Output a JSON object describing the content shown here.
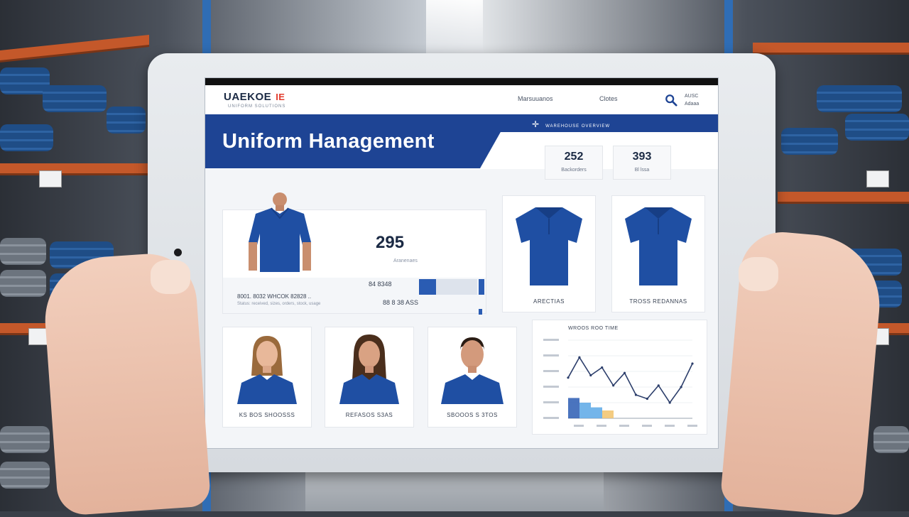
{
  "app": {
    "logo": "UAEKOE",
    "logo_mark": "IE",
    "logo_subtitle": "UNIFORM SOLUTIONS",
    "nav": [
      "Marsuuanos",
      "Clotes"
    ],
    "top_right": [
      "AUSC",
      "Adaaa"
    ]
  },
  "hero": {
    "title": "Uniform Hanagement",
    "right_text": "WAREHOUSE OVERVIEW"
  },
  "stats": [
    {
      "value": "252",
      "label": "Backorders"
    },
    {
      "value": "393",
      "label": "Bl lssa"
    }
  ],
  "summary": {
    "value": "295",
    "label": "Aranenaes",
    "footer_line1": "8001. 8032 WHCOK 82828 ..",
    "footer_line2": "Status: received, sizes, orders, stock, usage",
    "footer_num1": "84 8348",
    "footer_num2": "88 8 38 ASS"
  },
  "products": [
    {
      "label": "ARECTIAS"
    },
    {
      "label": "TROSS REDANNAS"
    }
  ],
  "staff": [
    {
      "label": "KS BOS SHOOSSS"
    },
    {
      "label": "REFASOS S3AS"
    },
    {
      "label": "SBOOOS S 3TOS"
    }
  ],
  "chart": {
    "title": "WROOS ROO TIME",
    "ylabels": [
      "",
      "",
      "",
      "",
      "",
      ""
    ],
    "xlabels": [
      "",
      "",
      "",
      "",
      "",
      ""
    ]
  },
  "chart_data": {
    "type": "line",
    "title": "WROOS ROO TIME",
    "x": [
      1,
      2,
      3,
      4,
      5,
      6,
      7,
      8,
      9,
      10,
      11,
      12
    ],
    "series": [
      {
        "values": [
          52,
          78,
          55,
          65,
          42,
          58,
          30,
          25,
          42,
          20,
          40,
          70
        ]
      }
    ],
    "bars": [
      {
        "values": [
          26,
          20,
          14,
          10
        ]
      }
    ],
    "ylim": [
      0,
      100
    ]
  },
  "colors": {
    "brand_blue": "#1e4494",
    "accent_red": "#e23b2c",
    "bar_blue": "#2a5cb3",
    "bar_light": "#5aa8e6",
    "bar_yellow": "#f2c36b"
  }
}
